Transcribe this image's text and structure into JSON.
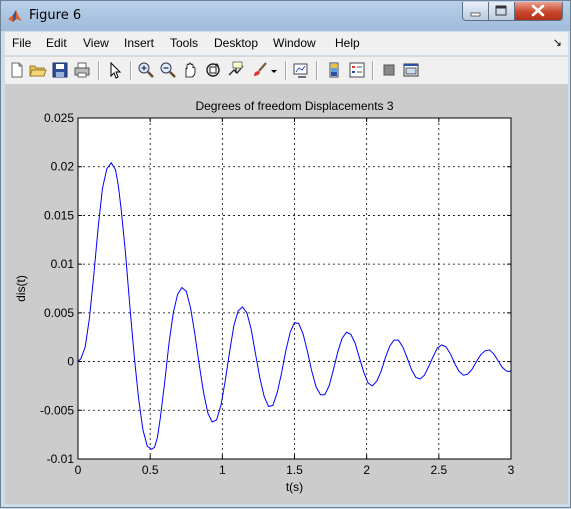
{
  "window": {
    "title": "Figure 6"
  },
  "menu": [
    "File",
    "Edit",
    "View",
    "Insert",
    "Tools",
    "Desktop",
    "Window",
    "Help"
  ],
  "toolbar": [
    "new-figure-icon",
    "open-file-icon",
    "save-icon",
    "print-icon",
    "pointer-icon",
    "zoom-in-icon",
    "zoom-out-icon",
    "pan-icon",
    "rotate-icon",
    "data-cursor-icon",
    "brush-icon",
    "brush-dropdown-icon",
    "link-plot-icon",
    "colorbar-icon",
    "legend-icon",
    "hide-plot-tools-icon",
    "show-plot-tools-icon"
  ],
  "chart_data": {
    "type": "line",
    "title": "Degrees of freedom Displacements 3",
    "xlabel": "t(s)",
    "ylabel": "dis(t)",
    "xlim": [
      0,
      3
    ],
    "ylim": [
      -0.01,
      0.025
    ],
    "xticks": [
      "0",
      "0.5",
      "1",
      "1.5",
      "2",
      "2.5",
      "3"
    ],
    "yticks": [
      "-0.01",
      "-0.005",
      "0",
      "0.005",
      "0.01",
      "0.015",
      "0.02",
      "0.025"
    ],
    "grid": true,
    "line_color": "#0000ff",
    "x": [
      0,
      0.02,
      0.05,
      0.08,
      0.11,
      0.14,
      0.17,
      0.2,
      0.23,
      0.26,
      0.28,
      0.3,
      0.33,
      0.36,
      0.39,
      0.42,
      0.45,
      0.48,
      0.51,
      0.53,
      0.55,
      0.57,
      0.6,
      0.63,
      0.66,
      0.69,
      0.72,
      0.75,
      0.78,
      0.81,
      0.84,
      0.87,
      0.9,
      0.93,
      0.96,
      0.99,
      1.02,
      1.05,
      1.08,
      1.11,
      1.14,
      1.17,
      1.2,
      1.23,
      1.26,
      1.29,
      1.32,
      1.35,
      1.38,
      1.41,
      1.44,
      1.47,
      1.5,
      1.53,
      1.56,
      1.59,
      1.62,
      1.65,
      1.68,
      1.71,
      1.74,
      1.77,
      1.8,
      1.83,
      1.86,
      1.89,
      1.92,
      1.95,
      1.98,
      2.01,
      2.04,
      2.07,
      2.1,
      2.13,
      2.16,
      2.19,
      2.22,
      2.25,
      2.28,
      2.31,
      2.34,
      2.37,
      2.4,
      2.43,
      2.46,
      2.49,
      2.52,
      2.55,
      2.58,
      2.61,
      2.64,
      2.67,
      2.7,
      2.73,
      2.76,
      2.79,
      2.82,
      2.85,
      2.88,
      2.91,
      2.94,
      2.97,
      3.0
    ],
    "values": [
      0,
      0.0003,
      0.0015,
      0.0045,
      0.009,
      0.0138,
      0.0178,
      0.0198,
      0.0204,
      0.0197,
      0.018,
      0.0155,
      0.011,
      0.0055,
      0.0005,
      -0.0038,
      -0.007,
      -0.0087,
      -0.009,
      -0.0088,
      -0.0078,
      -0.0058,
      -0.0022,
      0.0018,
      0.005,
      0.0069,
      0.0076,
      0.0072,
      0.0055,
      0.0028,
      -0.0003,
      -0.0032,
      -0.0053,
      -0.0062,
      -0.006,
      -0.0045,
      -0.002,
      0.001,
      0.0037,
      0.0052,
      0.0056,
      0.005,
      0.0033,
      0.0008,
      -0.0017,
      -0.0036,
      -0.0046,
      -0.0045,
      -0.0032,
      -0.0012,
      0.0011,
      0.003,
      0.004,
      0.0039,
      0.0028,
      0.001,
      -0.001,
      -0.0026,
      -0.0034,
      -0.0034,
      -0.0025,
      -0.0008,
      0.001,
      0.0024,
      0.003,
      0.0028,
      0.0019,
      0.0004,
      -0.0011,
      -0.0022,
      -0.0025,
      -0.002,
      -0.001,
      0.0004,
      0.0016,
      0.0022,
      0.0022,
      0.0015,
      0.0004,
      -0.0008,
      -0.0016,
      -0.0018,
      -0.0014,
      -0.0005,
      0.0005,
      0.0014,
      0.0017,
      0.0015,
      0.0008,
      -0.0002,
      -0.001,
      -0.0014,
      -0.0013,
      -0.0008,
      0,
      0.0007,
      0.0011,
      0.0012,
      0.0008,
      0.0001,
      -0.0006,
      -0.001,
      -0.001
    ]
  }
}
